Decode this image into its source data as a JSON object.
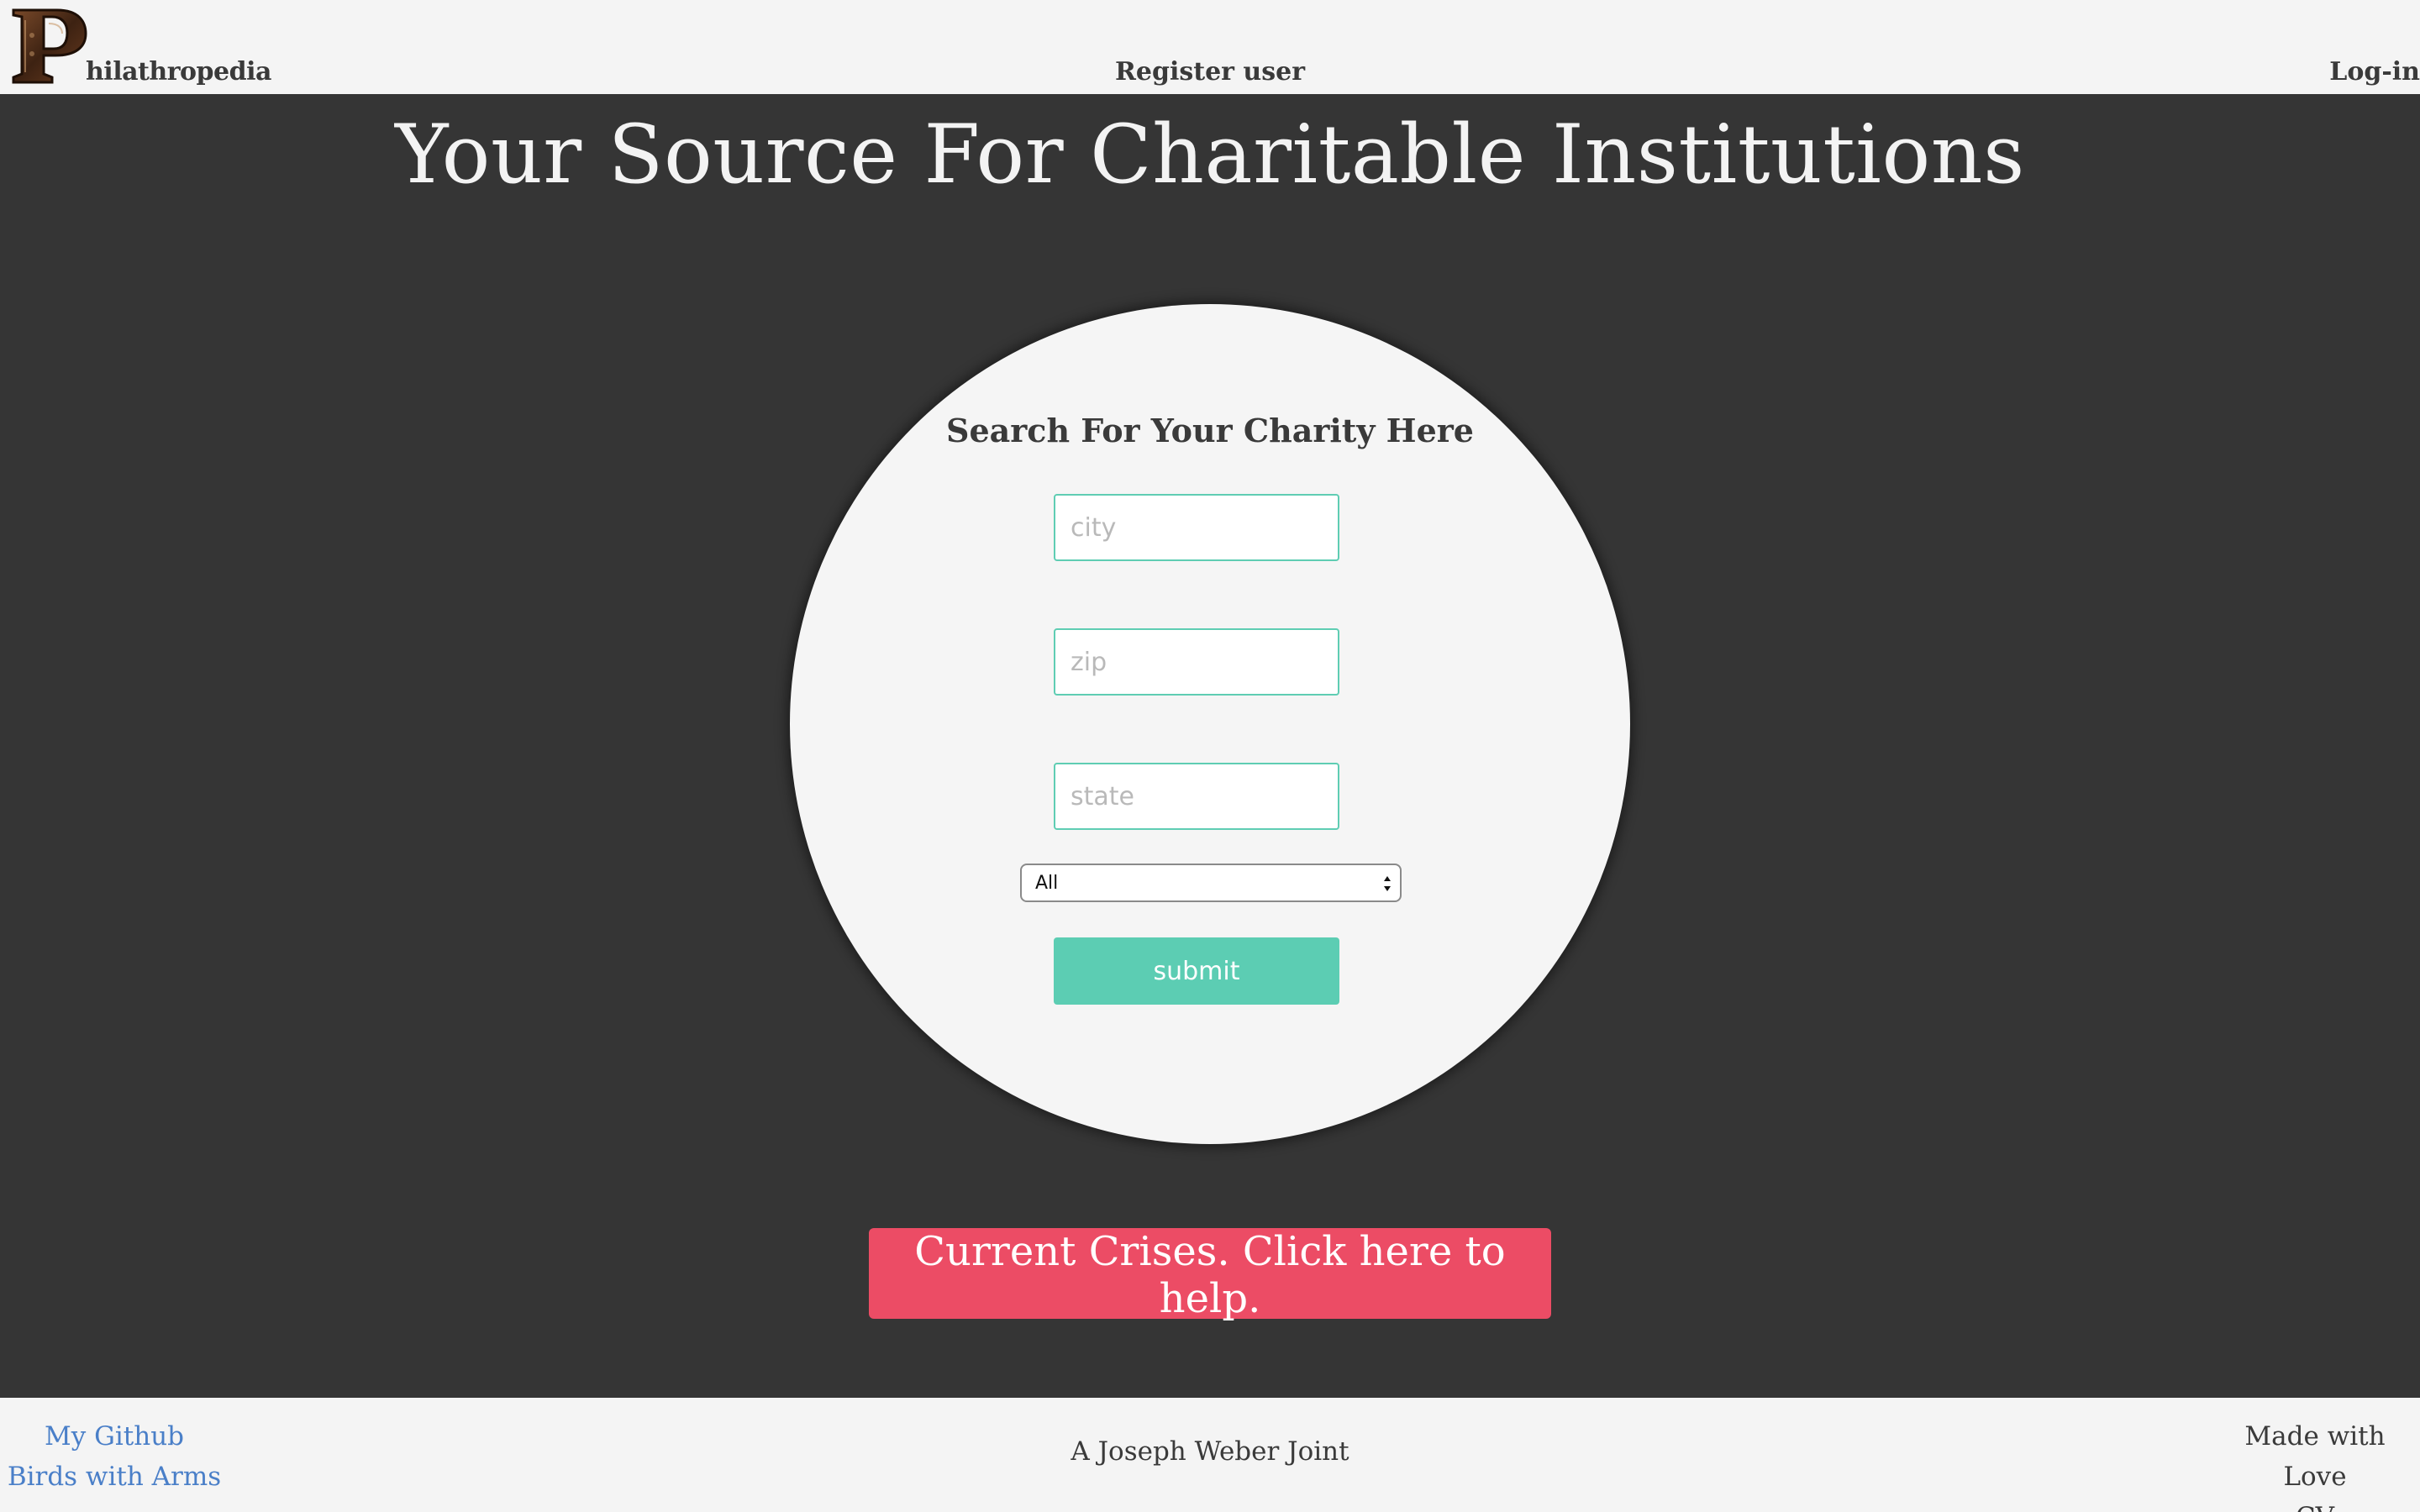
{
  "header": {
    "logo_icon": "ornate-letter-p-logo-icon",
    "logo_letter": "P",
    "brand_suffix": "hilathropedia",
    "register_label": "Register user",
    "login_label": "Log-in"
  },
  "hero": {
    "title": "Your Source For Charitable Institutions"
  },
  "search": {
    "heading": "Search For Your Charity Here",
    "city_placeholder": "city",
    "zip_placeholder": "zip",
    "state_placeholder": "state",
    "category_selected": "All",
    "submit_label": "submit"
  },
  "crisis": {
    "label": "Current Crises. Click here to help."
  },
  "footer": {
    "github_label": "My Github",
    "birds_label": "Birds with Arms",
    "center_text": "A Joseph Weber Joint",
    "made_with_love": "Made with Love",
    "cv_label": "CV"
  },
  "colors": {
    "accent_teal": "#5ccdb3",
    "crisis_red": "#ec4c65",
    "link_blue": "#4a7fc8",
    "dark_bg": "#353535",
    "light_bg": "#f4f4f4"
  }
}
